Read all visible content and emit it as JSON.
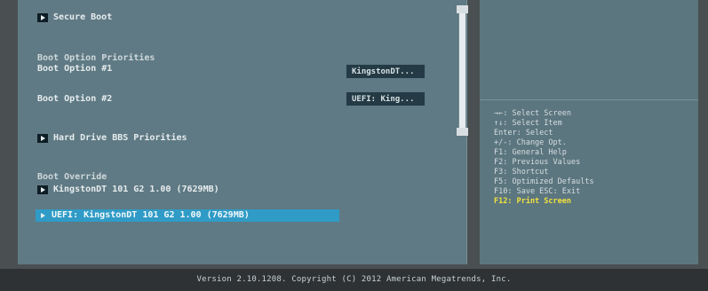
{
  "menu": {
    "secure_boot": "Secure Boot",
    "boot_option_priorities": "Boot Option Priorities",
    "boot_option_1": "Boot Option #1",
    "boot_option_1_value": "KingstonDT...",
    "boot_option_2": "Boot Option #2",
    "boot_option_2_value": "UEFI: King...",
    "hdd_bbs": "Hard Drive BBS Priorities",
    "boot_override": "Boot Override",
    "override_1": "KingstonDT 101 G2 1.00  (7629MB)",
    "override_2": "UEFI: KingstonDT 101 G2 1.00 (7629MB)"
  },
  "help": {
    "lines": [
      "→←: Select Screen",
      "↑↓: Select Item",
      "Enter: Select",
      "+/-: Change Opt.",
      "F1: General Help",
      "F2: Previous Values",
      "F3: Shortcut",
      "F5: Optimized Defaults",
      "F10: Save  ESC: Exit"
    ],
    "accent_line": "F12: Print Screen"
  },
  "footer": {
    "text": "Version 2.10.1208. Copyright (C) 2012 American Megatrends, Inc."
  },
  "colors": {
    "highlight": "#2f9bc6",
    "accent": "#f3e33d"
  }
}
